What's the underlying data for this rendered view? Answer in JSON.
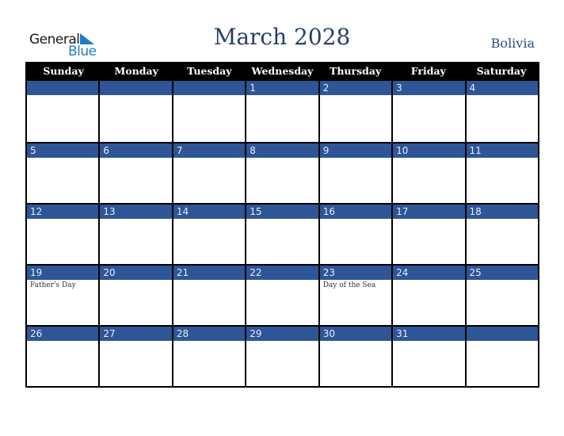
{
  "logo": {
    "line1": "General",
    "line2": "Blue"
  },
  "title": "March 2028",
  "country": "Bolivia",
  "weekdays": [
    "Sunday",
    "Monday",
    "Tuesday",
    "Wednesday",
    "Thursday",
    "Friday",
    "Saturday"
  ],
  "weeks": [
    [
      {
        "day": "",
        "event": ""
      },
      {
        "day": "",
        "event": ""
      },
      {
        "day": "",
        "event": ""
      },
      {
        "day": "1",
        "event": ""
      },
      {
        "day": "2",
        "event": ""
      },
      {
        "day": "3",
        "event": ""
      },
      {
        "day": "4",
        "event": ""
      }
    ],
    [
      {
        "day": "5",
        "event": ""
      },
      {
        "day": "6",
        "event": ""
      },
      {
        "day": "7",
        "event": ""
      },
      {
        "day": "8",
        "event": ""
      },
      {
        "day": "9",
        "event": ""
      },
      {
        "day": "10",
        "event": ""
      },
      {
        "day": "11",
        "event": ""
      }
    ],
    [
      {
        "day": "12",
        "event": ""
      },
      {
        "day": "13",
        "event": ""
      },
      {
        "day": "14",
        "event": ""
      },
      {
        "day": "15",
        "event": ""
      },
      {
        "day": "16",
        "event": ""
      },
      {
        "day": "17",
        "event": ""
      },
      {
        "day": "18",
        "event": ""
      }
    ],
    [
      {
        "day": "19",
        "event": "Father's Day"
      },
      {
        "day": "20",
        "event": ""
      },
      {
        "day": "21",
        "event": ""
      },
      {
        "day": "22",
        "event": ""
      },
      {
        "day": "23",
        "event": "Day of the Sea"
      },
      {
        "day": "24",
        "event": ""
      },
      {
        "day": "25",
        "event": ""
      }
    ],
    [
      {
        "day": "26",
        "event": ""
      },
      {
        "day": "27",
        "event": ""
      },
      {
        "day": "28",
        "event": ""
      },
      {
        "day": "29",
        "event": ""
      },
      {
        "day": "30",
        "event": ""
      },
      {
        "day": "31",
        "event": ""
      },
      {
        "day": "",
        "event": ""
      }
    ]
  ]
}
